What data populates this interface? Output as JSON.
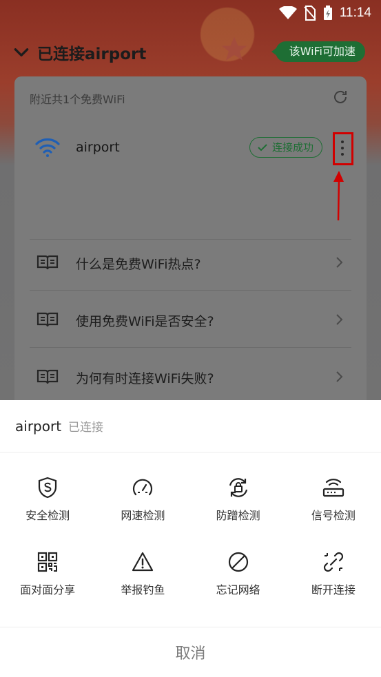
{
  "status_bar": {
    "time": "11:14"
  },
  "header": {
    "title": "已连接airport",
    "speed_badge": "该WiFi可加速"
  },
  "card": {
    "nearby_text": "附近共1个免费WiFi",
    "network": {
      "ssid": "airport",
      "status": "连接成功"
    },
    "faq": [
      {
        "question": "什么是免费WiFi热点?"
      },
      {
        "question": "使用免费WiFi是否安全?"
      },
      {
        "question": "为何有时连接WiFi失败?"
      }
    ]
  },
  "sheet": {
    "network_name": "airport",
    "connection_state": "已连接",
    "actions": [
      {
        "label": "安全检测",
        "icon": "shield-s-icon"
      },
      {
        "label": "网速检测",
        "icon": "speedometer-icon"
      },
      {
        "label": "防蹭检测",
        "icon": "lock-refresh-icon"
      },
      {
        "label": "信号检测",
        "icon": "router-icon"
      },
      {
        "label": "面对面分享",
        "icon": "qr-code-icon"
      },
      {
        "label": "举报钓鱼",
        "icon": "warning-icon"
      },
      {
        "label": "忘记网络",
        "icon": "forbidden-icon"
      },
      {
        "label": "断开连接",
        "icon": "broken-link-icon"
      }
    ],
    "cancel_label": "取消"
  },
  "colors": {
    "accent_green": "#1e6e34",
    "wifi_blue": "#1f5fb5",
    "annotation_red": "#d10000"
  }
}
